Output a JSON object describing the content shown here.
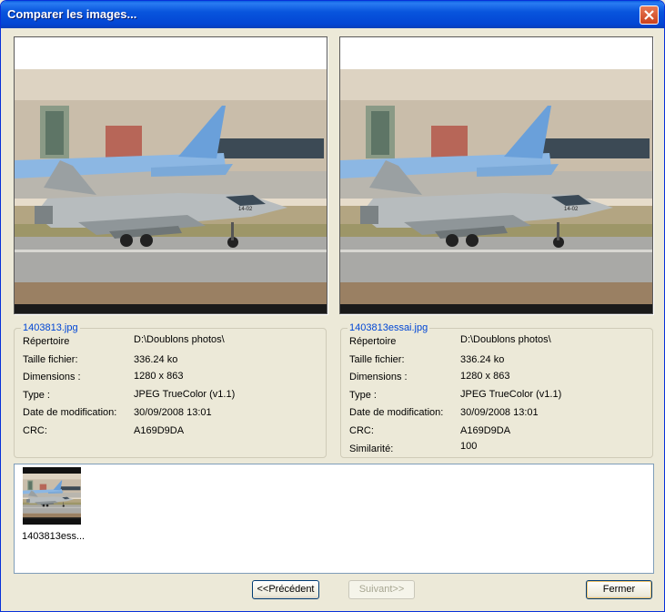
{
  "window": {
    "title": "Comparer les images..."
  },
  "left": {
    "filename": "1403813.jpg",
    "rows": [
      {
        "label": "Répertoire",
        "value": "D:\\Doublons photos\\"
      },
      {
        "label": "Taille fichier:",
        "value": "336.24 ko"
      },
      {
        "label": "Dimensions :",
        "value": "1280 x 863"
      },
      {
        "label": "Type :",
        "value": "JPEG TrueColor (v1.1)"
      },
      {
        "label": "Date de modification:",
        "value": "30/09/2008 13:01"
      },
      {
        "label": "CRC:",
        "value": "A169D9DA"
      }
    ]
  },
  "right": {
    "filename": "1403813essai.jpg",
    "rows": [
      {
        "label": "Répertoire",
        "value": "D:\\Doublons photos\\"
      },
      {
        "label": "Taille fichier:",
        "value": "336.24 ko"
      },
      {
        "label": "Dimensions :",
        "value": "1280 x 863"
      },
      {
        "label": "Type :",
        "value": "JPEG TrueColor (v1.1)"
      },
      {
        "label": "Date de modification:",
        "value": "30/09/2008 13:01"
      },
      {
        "label": "CRC:",
        "value": "A169D9DA"
      },
      {
        "label": "Similarité:",
        "value": "100"
      }
    ]
  },
  "results": {
    "items": [
      {
        "label": "1403813ess..."
      }
    ]
  },
  "buttons": {
    "previous": "<<Précédent",
    "next": "Suivant>>",
    "close": "Fermer"
  }
}
